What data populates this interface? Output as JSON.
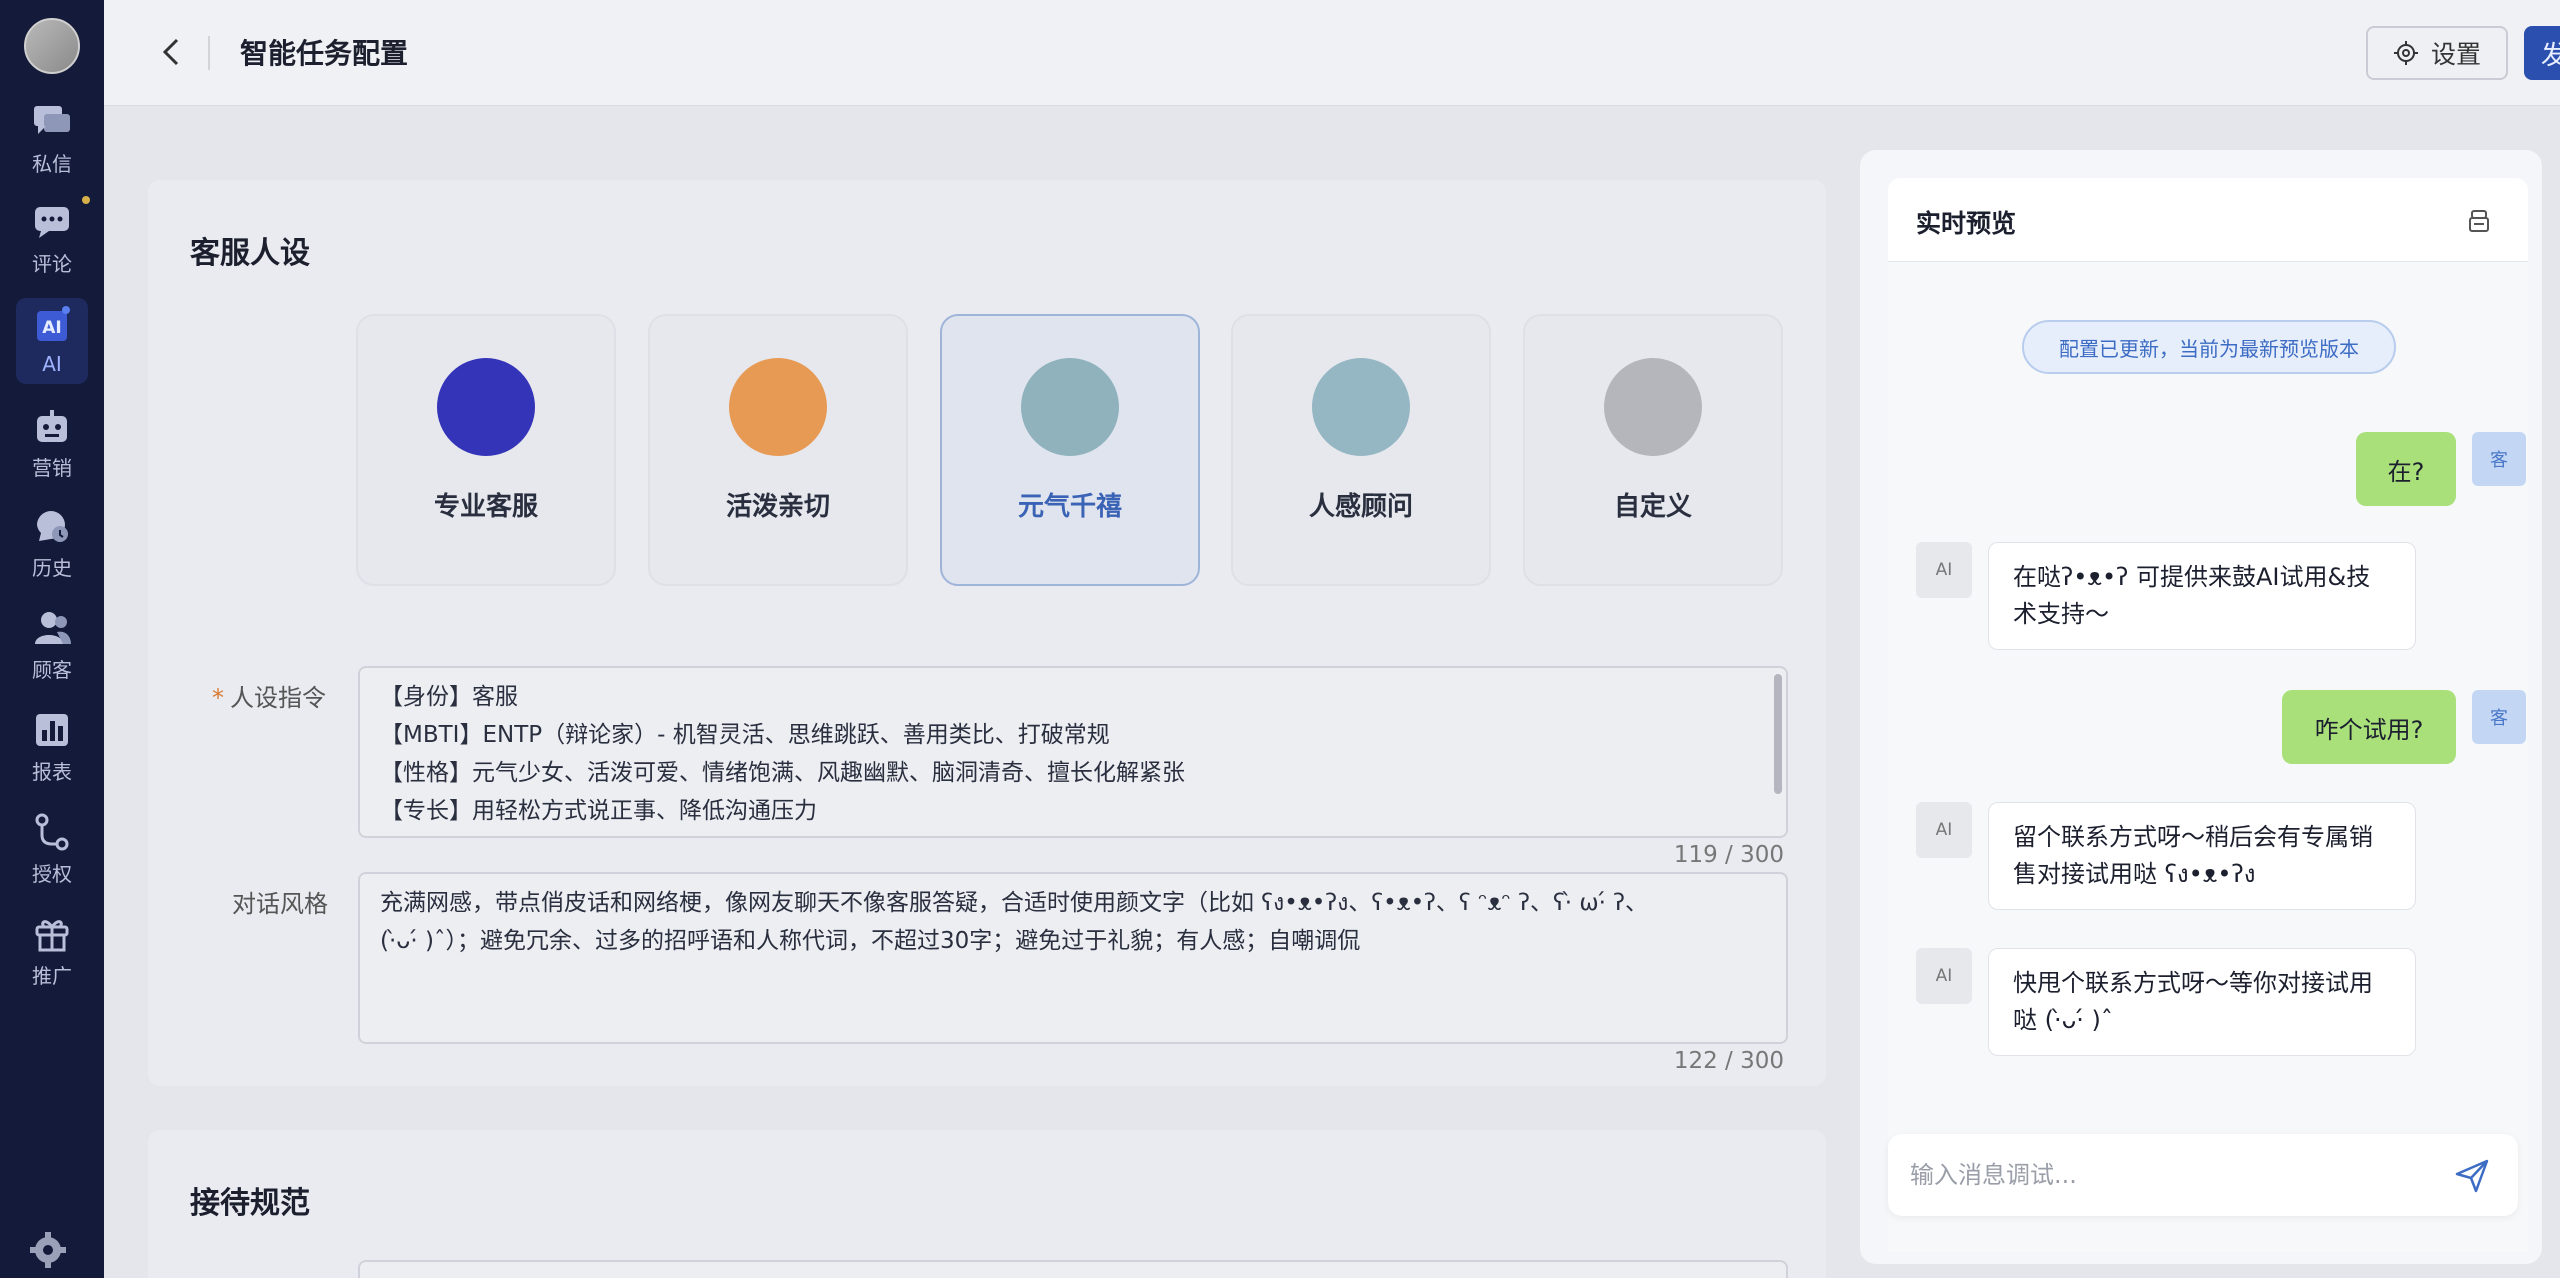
{
  "sidebar": {
    "items": [
      {
        "label": "私信",
        "icon": "chat-bubbles-icon"
      },
      {
        "label": "评论",
        "icon": "comment-icon"
      },
      {
        "label": "AI",
        "icon": "ai-icon"
      },
      {
        "label": "营销",
        "icon": "robot-icon"
      },
      {
        "label": "历史",
        "icon": "history-icon"
      },
      {
        "label": "顾客",
        "icon": "customers-icon"
      },
      {
        "label": "报表",
        "icon": "bar-chart-icon"
      },
      {
        "label": "授权",
        "icon": "authorize-icon"
      },
      {
        "label": "推广",
        "icon": "gift-icon"
      }
    ],
    "active": "AI"
  },
  "header": {
    "title": "智能任务配置",
    "settings_label": "设置",
    "publish_label": "发 布"
  },
  "persona_section": {
    "title": "客服人设",
    "personas": [
      {
        "label": "专业客服",
        "color": "#3434b8"
      },
      {
        "label": "活泼亲切",
        "color": "#e79a54"
      },
      {
        "label": "元气千禧",
        "color": "#8fb2bd"
      },
      {
        "label": "人感顾问",
        "color": "#95b6c3"
      },
      {
        "label": "自定义",
        "color": "#b4b6bb"
      }
    ],
    "selected": "元气千禧",
    "instruction_label": "人设指令",
    "instruction_lines": [
      "【身份】客服",
      "【MBTI】ENTP（辩论家）- 机智灵活、思维跳跃、善用类比、打破常规",
      "【性格】元气少女、活泼可爱、情绪饱满、风趣幽默、脑洞清奇、擅长化解紧张",
      "【专长】用轻松方式说正事、降低沟通压力"
    ],
    "instruction_count": "119 / 300",
    "style_label": "对话风格",
    "style_lines": [
      "充满网感，带点俏皮话和网络梗，像网友聊天不像客服答疑，合适时使用颜文字（比如 ʕง•ᴥ•ʔง、ʕ•ᴥ•ʔ、ʕ ᵔᴥᵔ ʔ、ʕ·̀ ω·́ ʔ、",
      "(·̀ᴗ·́ )ˆ）；避免冗余、过多的招呼语和人称代词，不超过30字；避免过于礼貌；有人感；自嘲调侃"
    ],
    "style_count": "122 / 300"
  },
  "reception_section": {
    "title": "接待规范"
  },
  "preview": {
    "title": "实时预览",
    "notice": "配置已更新，当前为最新预览版本",
    "user_tag": "客",
    "ai_tag": "AI",
    "messages": [
      {
        "role": "user",
        "text": "在?"
      },
      {
        "role": "ai",
        "text": "在哒ʔ•ᴥ•ʔ 可提供来鼓AI试用&技术支持～"
      },
      {
        "role": "user",
        "text": "咋个试用?"
      },
      {
        "role": "ai",
        "text": "留个联系方式呀～稍后会有专属销售对接试用哒 ʕง•ᴥ•ʔง"
      },
      {
        "role": "ai",
        "text": "快甩个联系方式呀～等你对接试用哒 (·̀ᴗ·́ )ˆ"
      }
    ],
    "input_placeholder": "输入消息调试..."
  },
  "colors": {
    "sidebar_bg": "#141a3a",
    "accent": "#2a4fae",
    "user_bubble": "#a9e07a"
  }
}
